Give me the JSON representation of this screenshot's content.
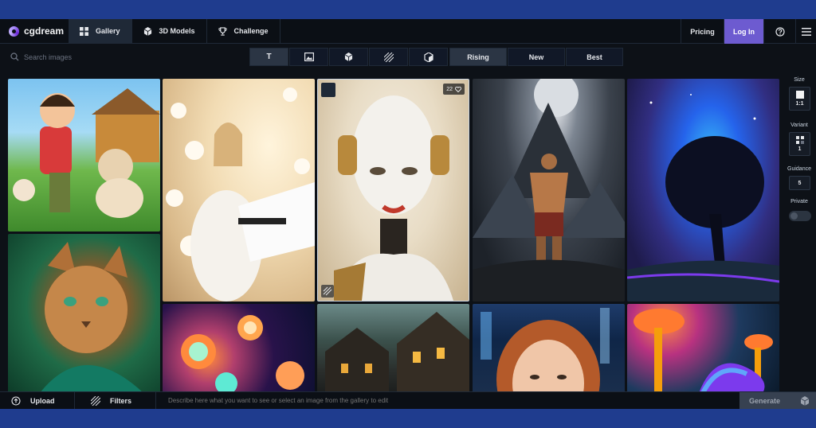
{
  "app": {
    "name": "cgdream"
  },
  "nav": {
    "tabs": [
      {
        "label": "Gallery",
        "icon": "grid-icon",
        "active": true
      },
      {
        "label": "3D Models",
        "icon": "cube-icon",
        "active": false
      },
      {
        "label": "Challenge",
        "icon": "trophy-icon",
        "active": false
      }
    ],
    "pricing": "Pricing",
    "login": "Log In",
    "help_icon": "help-circle-icon",
    "menu_icon": "hamburger-menu-icon"
  },
  "search": {
    "placeholder": "Search images"
  },
  "modes": [
    {
      "label": "T",
      "icon": "text-icon",
      "active": true
    },
    {
      "label": "",
      "icon": "image-icon",
      "active": false
    },
    {
      "label": "",
      "icon": "cube-icon",
      "active": false
    },
    {
      "label": "",
      "icon": "pattern-icon",
      "active": false
    },
    {
      "label": "",
      "icon": "cube-3d-icon",
      "active": false
    }
  ],
  "sorts": [
    {
      "label": "Rising",
      "active": true
    },
    {
      "label": "New",
      "active": false
    },
    {
      "label": "Best",
      "active": false
    }
  ],
  "gallery": {
    "hover_tile_likes": "22"
  },
  "rail": {
    "size_label": "Size",
    "size_value": "1:1",
    "variant_label": "Variant",
    "variant_value": "1",
    "guidance_label": "Guidance",
    "guidance_value": "5",
    "private_label": "Private"
  },
  "bottom": {
    "upload": "Upload",
    "filters": "Filters",
    "prompt_placeholder": "Describe here what you want to see or select an image from the gallery to edit",
    "generate": "Generate"
  },
  "colors": {
    "accent": "#6d5bd0",
    "background": "#0d1117",
    "frame": "#1f3c8e"
  }
}
